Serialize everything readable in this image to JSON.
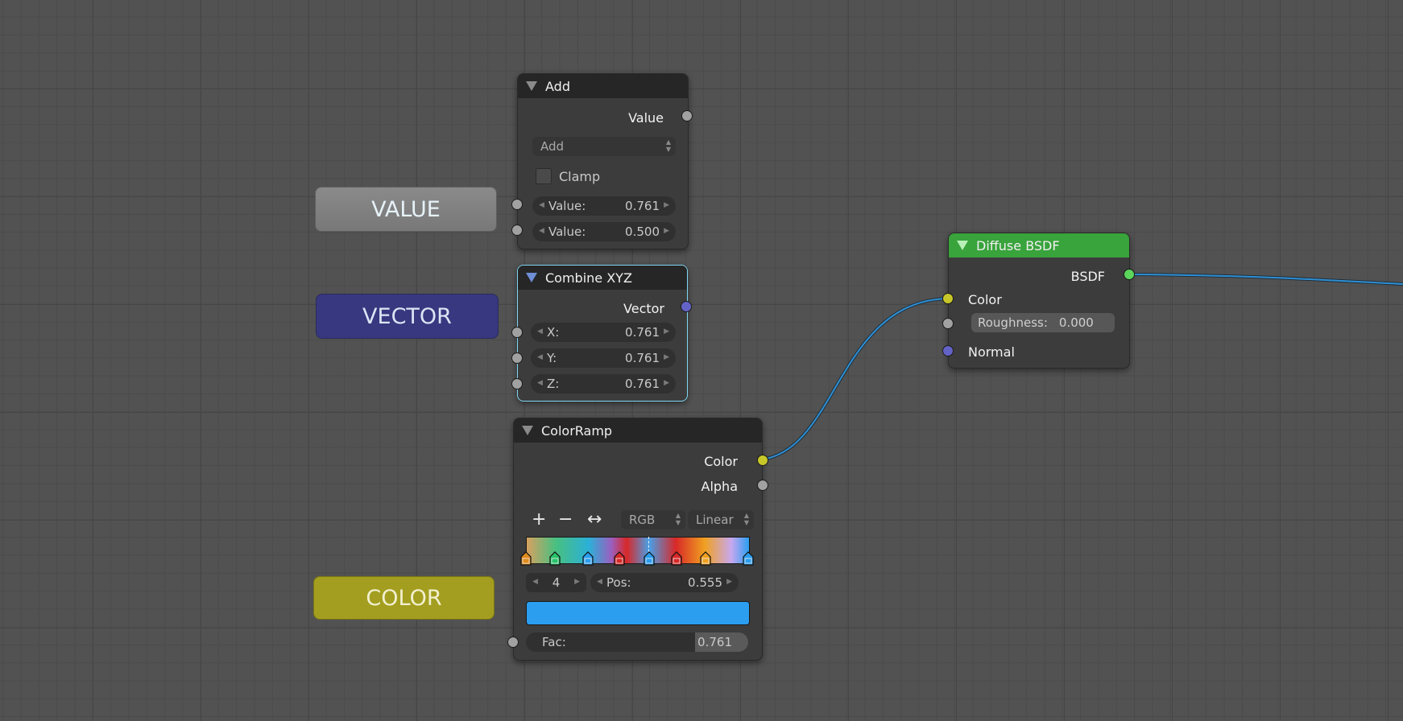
{
  "tags": {
    "value": "VALUE",
    "vector": "VECTOR",
    "color": "COLOR"
  },
  "add_node": {
    "title": "Add",
    "output": "Value",
    "operation": "Add",
    "clamp_label": "Clamp",
    "clamp_checked": false,
    "inputs": [
      {
        "label": "Value:",
        "value": "0.761"
      },
      {
        "label": "Value:",
        "value": "0.500"
      }
    ]
  },
  "combine_node": {
    "title": "Combine XYZ",
    "output": "Vector",
    "inputs": [
      {
        "label": "X:",
        "value": "0.761"
      },
      {
        "label": "Y:",
        "value": "0.761"
      },
      {
        "label": "Z:",
        "value": "0.761"
      }
    ]
  },
  "ramp_node": {
    "title": "ColorRamp",
    "outputs": [
      "Color",
      "Alpha"
    ],
    "toolbar": {
      "add": "+",
      "remove": "−",
      "flip": "↔"
    },
    "color_mode": "RGB",
    "interpolation": "Linear",
    "active_index": "4",
    "pos_label": "Pos:",
    "pos_value": "0.555",
    "active_color": "#2b9ef0",
    "stop_colors": [
      "#e08a1c",
      "#27c46a",
      "#2b9ef0",
      "#d82828",
      "#2b9ef0",
      "#d82828",
      "#f0a020",
      "#2b9ef0"
    ],
    "fac_label": "Fac:",
    "fac_value": "0.761",
    "fac_fraction": 0.761
  },
  "diffuse_node": {
    "title": "Diffuse BSDF",
    "output": "BSDF",
    "inputs": {
      "color": "Color",
      "roughness_label": "Roughness:",
      "roughness_value": "0.000",
      "normal": "Normal"
    }
  },
  "colors": {
    "link": "#2f8fd4",
    "socket_color": "#c7c729",
    "socket_vector": "#6363c7",
    "socket_shader": "#5bd65b",
    "header_shader": "#39a33c"
  }
}
